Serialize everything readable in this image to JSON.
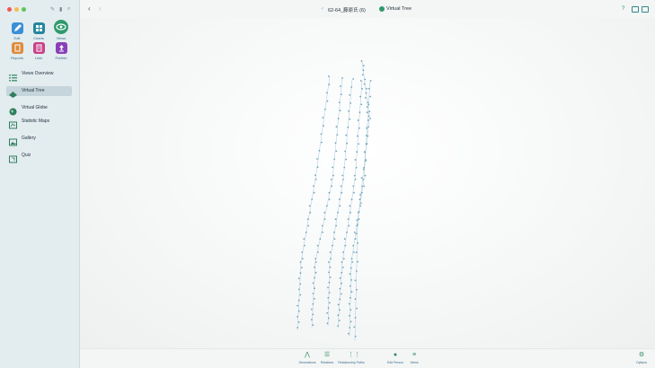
{
  "window": {
    "title": "62-64_藤原氏 (6)",
    "subtitle_view": "Virtual Tree"
  },
  "toolbar": {
    "edit": "Edit",
    "charts": "Charts",
    "views": "Views",
    "reports": "Reports",
    "lists": "Lists",
    "publish": "Publish"
  },
  "sidebar": {
    "items": [
      {
        "label": "Views Overview",
        "icon": "grid-icon"
      },
      {
        "label": "Virtual Tree",
        "icon": "tree-icon"
      },
      {
        "label": "Virtual Globe",
        "icon": "globe-icon"
      },
      {
        "label": "Statistic Maps",
        "icon": "map-icon"
      },
      {
        "label": "Gallery",
        "icon": "gallery-icon"
      },
      {
        "label": "Quiz",
        "icon": "quiz-icon"
      }
    ]
  },
  "bottombar": {
    "generations": "Generations",
    "relatives": "Relatives",
    "relationship_paths": "Relationship Paths",
    "edit_person": "Edit Person",
    "views": "Views",
    "options": "Options"
  },
  "colors": {
    "accent": "#2f8a5d",
    "selected": "#c6d5db",
    "node": "#6fa3bb"
  }
}
